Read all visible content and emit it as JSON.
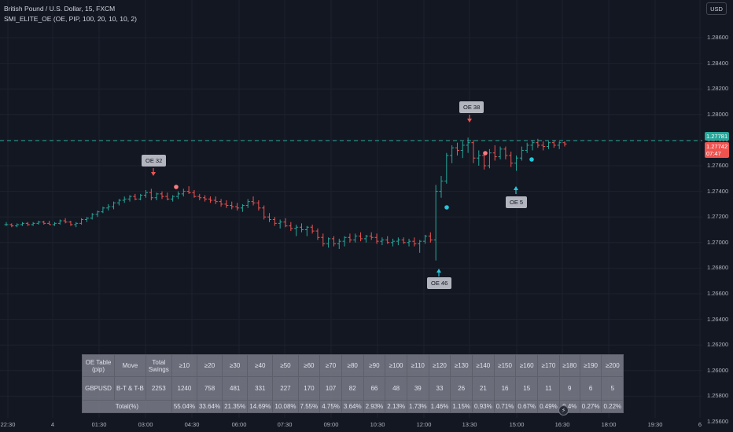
{
  "header": {
    "symbol": "British Pound / U.S. Dollar, 15, FXCM",
    "indicator": "SMI_ELITE_OE (OE, PIP, 100, 20, 10, 10, 2)"
  },
  "currency_button": "USD",
  "price_axis": [
    "1.28600",
    "1.28400",
    "1.28200",
    "1.28000",
    "1.27800",
    "1.27600",
    "1.27400",
    "1.27200",
    "1.27000",
    "1.26800",
    "1.26600",
    "1.26400",
    "1.26200",
    "1.26000",
    "1.25800",
    "1.25600"
  ],
  "price_tags": {
    "last": "1.27781",
    "current": "1.27742",
    "countdown": "07:47"
  },
  "time_axis": [
    "22:30",
    "4",
    "01:30",
    "03:00",
    "04:30",
    "06:00",
    "07:30",
    "09:00",
    "10:30",
    "12:00",
    "13:30",
    "15:00",
    "16:30",
    "18:00",
    "19:30",
    "6"
  ],
  "markers": {
    "oe32": "OE 32",
    "oe38": "OE 38",
    "oe46": "OE 46",
    "oe5": "OE 5"
  },
  "colors": {
    "background": "#131722",
    "bull": "#26a69a",
    "bear": "#ef5350",
    "dashed_line": "#26a69a",
    "dot_bear": "#f77c80",
    "dot_bull": "#26c6da"
  },
  "oe_table": {
    "header": [
      "OE Table (pip)",
      "Move",
      "Total Swings",
      "≥10",
      "≥20",
      "≥30",
      "≥40",
      "≥50",
      "≥60",
      "≥70",
      "≥80",
      "≥90",
      "≥100",
      "≥110",
      "≥120",
      "≥130",
      "≥140",
      "≥150",
      "≥160",
      "≥170",
      "≥180",
      "≥190",
      "≥200"
    ],
    "row_pair": [
      "GBPUSD",
      "B-T & T-B",
      "2253",
      "1240",
      "758",
      "481",
      "331",
      "227",
      "170",
      "107",
      "82",
      "66",
      "48",
      "39",
      "33",
      "26",
      "21",
      "16",
      "15",
      "11",
      "9",
      "6",
      "5"
    ],
    "row_total": [
      "Total(%)",
      "55.04%",
      "33.64%",
      "21.35%",
      "14.69%",
      "10.08%",
      "7.55%",
      "4.75%",
      "3.64%",
      "2.93%",
      "2.13%",
      "1.73%",
      "1.46%",
      "1.15%",
      "0.93%",
      "0.71%",
      "0.67%",
      "0.49%",
      "0.4%",
      "0.27%",
      "0.22%"
    ]
  },
  "chart_data": {
    "type": "candlestick",
    "candles": [
      [
        1.2714,
        1.2716,
        1.2713,
        1.2714
      ],
      [
        1.2714,
        1.2715,
        1.2712,
        1.2713
      ],
      [
        1.2713,
        1.2715,
        1.2712,
        1.2714
      ],
      [
        1.2714,
        1.2716,
        1.2713,
        1.2715
      ],
      [
        1.2715,
        1.2716,
        1.2713,
        1.2714
      ],
      [
        1.2714,
        1.2716,
        1.2713,
        1.2715
      ],
      [
        1.2715,
        1.2717,
        1.2714,
        1.2716
      ],
      [
        1.2716,
        1.2717,
        1.2714,
        1.2715
      ],
      [
        1.2715,
        1.2717,
        1.2714,
        1.2714
      ],
      [
        1.2714,
        1.2716,
        1.2713,
        1.2715
      ],
      [
        1.2715,
        1.2718,
        1.2714,
        1.2717
      ],
      [
        1.2717,
        1.2719,
        1.2715,
        1.2716
      ],
      [
        1.2716,
        1.2717,
        1.2713,
        1.2714
      ],
      [
        1.2714,
        1.2716,
        1.2712,
        1.2715
      ],
      [
        1.2715,
        1.2719,
        1.2714,
        1.2718
      ],
      [
        1.2718,
        1.272,
        1.2716,
        1.2719
      ],
      [
        1.2719,
        1.2723,
        1.2718,
        1.2722
      ],
      [
        1.2722,
        1.2725,
        1.272,
        1.2724
      ],
      [
        1.2724,
        1.2728,
        1.2723,
        1.2727
      ],
      [
        1.2727,
        1.273,
        1.2725,
        1.2728
      ],
      [
        1.2728,
        1.2732,
        1.2726,
        1.2731
      ],
      [
        1.2731,
        1.2734,
        1.2729,
        1.2733
      ],
      [
        1.2733,
        1.2736,
        1.2731,
        1.2734
      ],
      [
        1.2734,
        1.2737,
        1.2732,
        1.2736
      ],
      [
        1.2736,
        1.2738,
        1.2733,
        1.2734
      ],
      [
        1.2734,
        1.2738,
        1.2733,
        1.2737
      ],
      [
        1.2737,
        1.2741,
        1.2735,
        1.2739
      ],
      [
        1.2739,
        1.2742,
        1.2733,
        1.2735
      ],
      [
        1.2735,
        1.2739,
        1.2733,
        1.2738
      ],
      [
        1.2738,
        1.274,
        1.2734,
        1.2736
      ],
      [
        1.2736,
        1.2739,
        1.2733,
        1.2734
      ],
      [
        1.2734,
        1.2737,
        1.2732,
        1.2736
      ],
      [
        1.2736,
        1.274,
        1.2734,
        1.2738
      ],
      [
        1.2738,
        1.2742,
        1.2736,
        1.274
      ],
      [
        1.274,
        1.2744,
        1.2738,
        1.2739
      ],
      [
        1.2739,
        1.2741,
        1.2735,
        1.2736
      ],
      [
        1.2736,
        1.2738,
        1.2733,
        1.2735
      ],
      [
        1.2735,
        1.2737,
        1.2732,
        1.2734
      ],
      [
        1.2734,
        1.2736,
        1.2731,
        1.2733
      ],
      [
        1.2733,
        1.2736,
        1.273,
        1.2732
      ],
      [
        1.2732,
        1.2734,
        1.2728,
        1.273
      ],
      [
        1.273,
        1.2733,
        1.2727,
        1.2729
      ],
      [
        1.2729,
        1.2732,
        1.2726,
        1.2728
      ],
      [
        1.2728,
        1.2731,
        1.2725,
        1.2727
      ],
      [
        1.2727,
        1.273,
        1.2724,
        1.2729
      ],
      [
        1.2729,
        1.2734,
        1.2727,
        1.2732
      ],
      [
        1.2732,
        1.2736,
        1.2729,
        1.2731
      ],
      [
        1.2731,
        1.2733,
        1.2725,
        1.2727
      ],
      [
        1.2727,
        1.2729,
        1.2718,
        1.272
      ],
      [
        1.272,
        1.2723,
        1.2716,
        1.2718
      ],
      [
        1.2718,
        1.272,
        1.2713,
        1.2715
      ],
      [
        1.2715,
        1.2718,
        1.2711,
        1.2716
      ],
      [
        1.2716,
        1.2719,
        1.2712,
        1.2713
      ],
      [
        1.2713,
        1.2716,
        1.2709,
        1.2711
      ],
      [
        1.2711,
        1.2714,
        1.2705,
        1.2712
      ],
      [
        1.2712,
        1.2715,
        1.2708,
        1.271
      ],
      [
        1.271,
        1.2713,
        1.2705,
        1.2712
      ],
      [
        1.2712,
        1.2714,
        1.2707,
        1.2709
      ],
      [
        1.2709,
        1.2711,
        1.2702,
        1.2704
      ],
      [
        1.2704,
        1.2707,
        1.2697,
        1.2699
      ],
      [
        1.2699,
        1.2704,
        1.2696,
        1.2703
      ],
      [
        1.2703,
        1.2705,
        1.2697,
        1.2699
      ],
      [
        1.2699,
        1.2703,
        1.2695,
        1.2701
      ],
      [
        1.2701,
        1.2705,
        1.2697,
        1.2704
      ],
      [
        1.2704,
        1.2707,
        1.27,
        1.2702
      ],
      [
        1.2702,
        1.2707,
        1.27,
        1.2705
      ],
      [
        1.2705,
        1.2708,
        1.2701,
        1.2703
      ],
      [
        1.2703,
        1.2706,
        1.27,
        1.2705
      ],
      [
        1.2705,
        1.2708,
        1.2702,
        1.2704
      ],
      [
        1.2704,
        1.2707,
        1.2699,
        1.2701
      ],
      [
        1.2701,
        1.2704,
        1.2698,
        1.2702
      ],
      [
        1.2702,
        1.2705,
        1.2699,
        1.27
      ],
      [
        1.27,
        1.2703,
        1.2697,
        1.2701
      ],
      [
        1.2701,
        1.2704,
        1.2698,
        1.2702
      ],
      [
        1.2702,
        1.2704,
        1.2699,
        1.27
      ],
      [
        1.27,
        1.2703,
        1.2697,
        1.2701
      ],
      [
        1.2701,
        1.2704,
        1.2697,
        1.2699
      ],
      [
        1.2699,
        1.2702,
        1.2692,
        1.2701
      ],
      [
        1.2701,
        1.2706,
        1.2699,
        1.2705
      ],
      [
        1.2705,
        1.2708,
        1.27,
        1.2702
      ],
      [
        1.2702,
        1.2745,
        1.2686,
        1.274
      ],
      [
        1.274,
        1.2752,
        1.2735,
        1.2748
      ],
      [
        1.2748,
        1.277,
        1.2746,
        1.2768
      ],
      [
        1.2768,
        1.2776,
        1.2762,
        1.2774
      ],
      [
        1.2774,
        1.2778,
        1.2768,
        1.2772
      ],
      [
        1.2772,
        1.2779,
        1.2766,
        1.2776
      ],
      [
        1.2776,
        1.2782,
        1.277,
        1.2778
      ],
      [
        1.2778,
        1.278,
        1.2762,
        1.2766
      ],
      [
        1.2766,
        1.2772,
        1.276,
        1.2768
      ],
      [
        1.2768,
        1.277,
        1.2757,
        1.276
      ],
      [
        1.276,
        1.2773,
        1.2758,
        1.277
      ],
      [
        1.277,
        1.2776,
        1.2764,
        1.2767
      ],
      [
        1.2767,
        1.2775,
        1.2765,
        1.2773
      ],
      [
        1.2773,
        1.2775,
        1.2765,
        1.2768
      ],
      [
        1.2768,
        1.2771,
        1.2759,
        1.2762
      ],
      [
        1.2762,
        1.2768,
        1.2756,
        1.2766
      ],
      [
        1.2766,
        1.2775,
        1.2764,
        1.2772
      ],
      [
        1.2772,
        1.2778,
        1.277,
        1.2776
      ],
      [
        1.2776,
        1.278,
        1.2772,
        1.2778
      ],
      [
        1.2778,
        1.2781,
        1.2774,
        1.2776
      ],
      [
        1.2776,
        1.2779,
        1.2772,
        1.2775
      ],
      [
        1.2775,
        1.2779,
        1.2773,
        1.2778
      ],
      [
        1.2778,
        1.278,
        1.2774,
        1.2776
      ],
      [
        1.2776,
        1.2779,
        1.2773,
        1.2778
      ],
      [
        1.2778,
        1.2779,
        1.2775,
        1.2777
      ]
    ],
    "ylim": [
      1.255,
      1.288
    ]
  }
}
